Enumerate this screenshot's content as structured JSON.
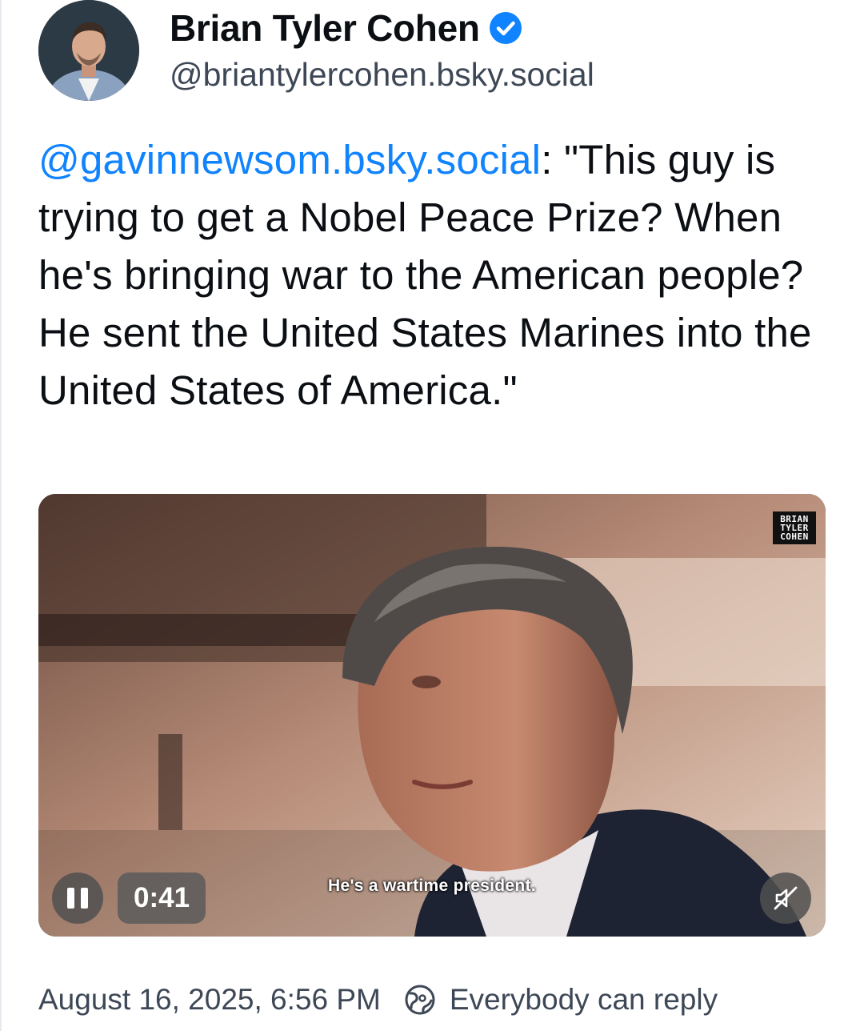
{
  "author": {
    "display_name": "Brian Tyler Cohen",
    "handle": "@briantylercohen.bsky.social",
    "verified": true,
    "verified_color": "#1083fe"
  },
  "post": {
    "mention": "@gavinnewsom.bsky.social",
    "text": ": \"This guy is trying to get a Nobel Peace Prize? When he's bringing war to the American people? He sent the United States Marines into the United States of America.\"",
    "link_color": "#1083fe"
  },
  "video": {
    "watermark_lines": [
      "BRIAN",
      "TYLER",
      "COHEN"
    ],
    "elapsed_time": "0:41",
    "caption": "He's a wartime president.",
    "state": "playing",
    "muted": true,
    "pause_icon": "pause-icon",
    "mute_icon": "speaker-muted-icon"
  },
  "footer": {
    "timestamp": "August 16, 2025, 6:56 PM",
    "reply_setting": "Everybody can reply",
    "reply_icon": "globe-icon"
  }
}
